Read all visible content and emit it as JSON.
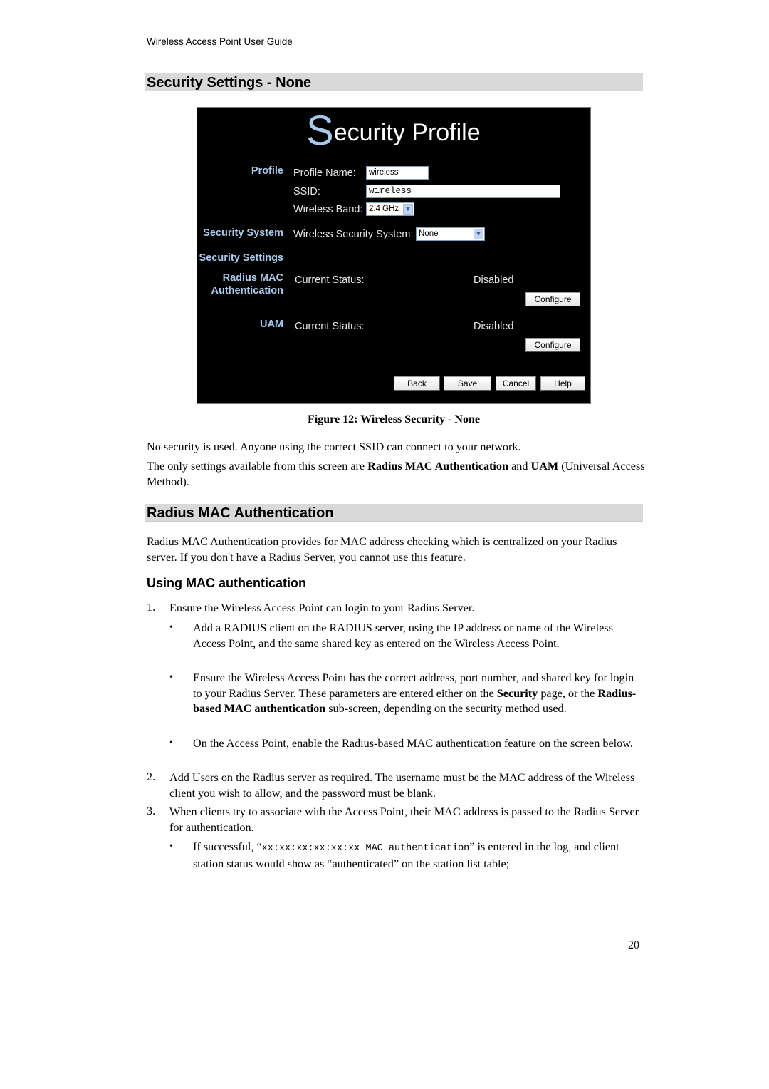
{
  "running_header": "Wireless Access Point User Guide",
  "section1": {
    "title": "Security Settings - None"
  },
  "figure": {
    "title_initial": "S",
    "title_rest": "ecurity Profile",
    "sections": {
      "profile": "Profile",
      "security_system": "Security System",
      "security_settings": "Security Settings",
      "radius_mac_line1": "Radius MAC",
      "radius_mac_line2": "Authentication",
      "uam": "UAM"
    },
    "fields": {
      "profile_name_label": "Profile Name:",
      "profile_name_value": "wireless",
      "ssid_label": "SSID:",
      "ssid_value": "wireless",
      "band_label": "Wireless Band:",
      "band_value": "2.4 GHz",
      "security_system_label": "Wireless Security System:",
      "security_system_value": "None"
    },
    "radius_status_label": "Current Status:",
    "radius_status_value": "Disabled",
    "uam_status_label": "Current Status:",
    "uam_status_value": "Disabled",
    "buttons": {
      "configure": "Configure",
      "back": "Back",
      "save": "Save",
      "cancel": "Cancel",
      "help": "Help"
    },
    "dropdown_icon": "chevron-down-icon",
    "caption": "Figure 12: Wireless Security - None"
  },
  "intro": {
    "p1": "No security is used. Anyone using the correct SSID can connect to your network.",
    "p2_a": "The only settings available from this screen are ",
    "p2_b": "Radius MAC Authentication",
    "p2_c": " and ",
    "p2_d": "UAM",
    "p2_e": " (Universal Access Method)."
  },
  "section2": {
    "title": "Radius MAC Authentication",
    "p1": "Radius MAC Authentication provides for MAC address checking which is centralized on your Radius server. If you don't have a Radius Server, you cannot use this feature.",
    "subheading": "Using MAC authentication",
    "steps": [
      {
        "num": "1.",
        "text": "Ensure the Wireless Access Point can login to your Radius Server."
      },
      {
        "num": "2.",
        "text": "Add Users on the Radius server as required. The username must be the MAC address of the Wireless client you wish to allow, and the password must be blank."
      },
      {
        "num": "3.",
        "text": "When clients try to associate with the Access Point, their MAC address is passed to the Radius Server for authentication."
      }
    ],
    "bullet_glyph": "•",
    "step1_bullets": {
      "b1": "Add a RADIUS client on the RADIUS server, using the IP address or name of the Wireless Access Point, and the same shared key as entered on the Wireless Access Point.",
      "b2_a": "Ensure the Wireless Access Point has the correct address, port number, and shared key for login to your Radius Server. These parameters are entered either on the ",
      "b2_b": "Security",
      "b2_c": " page, or the ",
      "b2_d": "Radius-based MAC authentication",
      "b2_e": " sub-screen, depending on the security method used.",
      "b3": "On the Access Point, enable the Radius-based MAC authentication feature on the screen below."
    },
    "step3_bullets": {
      "b1_a": "If successful, “",
      "b1_code": "xx:xx:xx:xx:xx:xx MAC authentication",
      "b1_b": "” is entered in the log, and client station status would show as “authenticated” on the station list table;"
    }
  },
  "page_number": "20"
}
